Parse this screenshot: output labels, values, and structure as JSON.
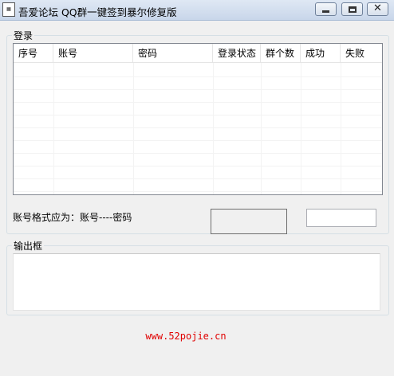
{
  "window": {
    "title": "吾爱论坛 QQ群一键签到暴尔修复版",
    "icon": "app-grid-icon",
    "controls": [
      "minimize-icon",
      "maximize-icon",
      "close-icon"
    ]
  },
  "login_group": {
    "label": "登录",
    "columns": [
      "序号",
      "账号",
      "密码",
      "登录状态",
      "群个数",
      "成功",
      "失败"
    ],
    "rows": []
  },
  "format_hint": "账号格式应为：账号----密码",
  "status_box_1": "",
  "status_box_2": "",
  "output_group": {
    "label": "输出框",
    "content": ""
  },
  "footer": {
    "link": "www.52pojie.cn",
    "color": "#e00000"
  }
}
